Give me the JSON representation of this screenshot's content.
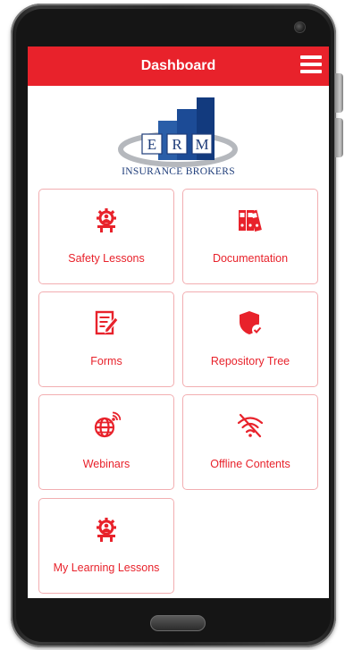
{
  "header": {
    "title": "Dashboard"
  },
  "logo": {
    "letters": [
      "E",
      "R",
      "M"
    ],
    "tagline": "INSURANCE BROKERS"
  },
  "tiles": [
    {
      "label": "Safety Lessons",
      "icon": "gear-person-icon"
    },
    {
      "label": "Documentation",
      "icon": "binders-icon"
    },
    {
      "label": "Forms",
      "icon": "form-pencil-icon"
    },
    {
      "label": "Repository Tree",
      "icon": "shield-check-icon"
    },
    {
      "label": "Webinars",
      "icon": "globe-signal-icon"
    },
    {
      "label": "Offline Contents",
      "icon": "wifi-off-icon"
    },
    {
      "label": "My Learning Lessons",
      "icon": "gear-person-icon"
    }
  ],
  "colors": {
    "accent": "#e8222b",
    "logo_blue": "#1f3d7a",
    "tile_border": "#f2aeb1"
  }
}
